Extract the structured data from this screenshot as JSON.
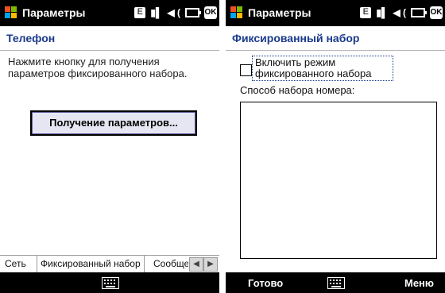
{
  "screen1": {
    "titlebar": {
      "title": "Параметры",
      "edge": "E",
      "ok": "OK"
    },
    "page_title": "Телефон",
    "instruction": "Нажмите кнопку для получения параметров фиксированного набора.",
    "button_label": "Получение параметров...",
    "tabs": [
      "Сеть",
      "Фиксированный набор",
      "Сообще"
    ]
  },
  "screen2": {
    "titlebar": {
      "title": "Параметры",
      "edge": "E",
      "ok": "OK"
    },
    "page_title": "Фиксированный набор",
    "checkbox_label": "Включить режим фиксированного набора",
    "checkbox_checked": false,
    "dial_mode_label": "Способ набора номера:",
    "softkeys": {
      "left": "Готово",
      "right": "Меню"
    }
  },
  "icons": [
    "windows-start-icon",
    "edge-icon",
    "signal-icon",
    "speaker-icon",
    "battery-icon",
    "keyboard-icon",
    "chevron-left-icon",
    "chevron-right-icon"
  ]
}
